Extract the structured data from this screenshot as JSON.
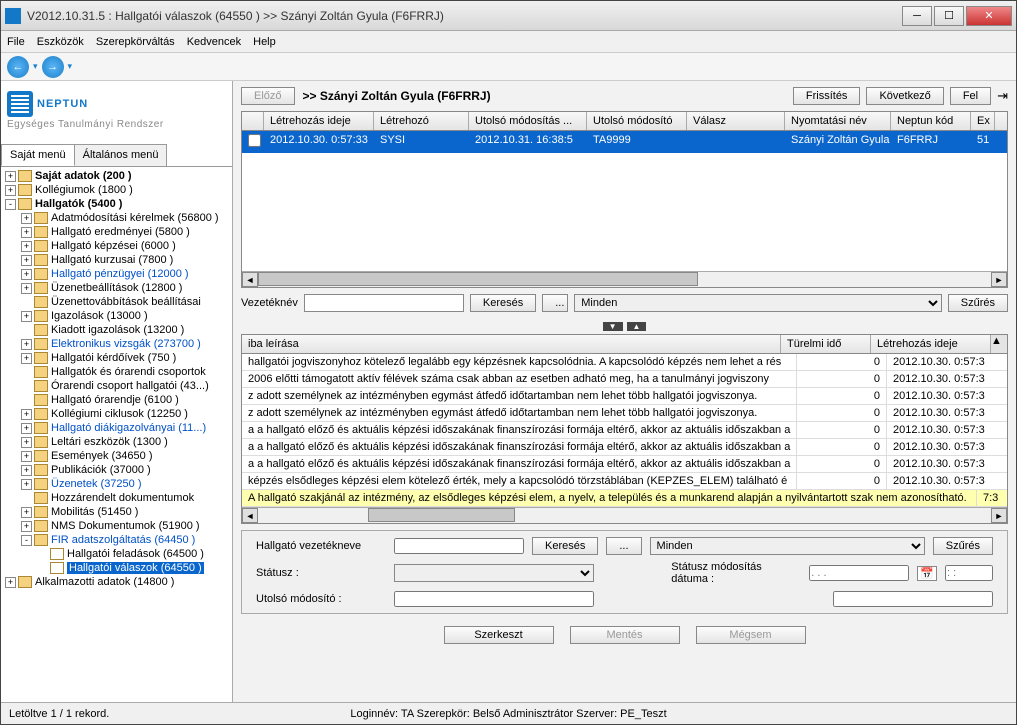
{
  "window": {
    "title": "V2012.10.31.5 : Hallgatói válaszok (64550  )  >> Szányi Zoltán Gyula (F6FRRJ)"
  },
  "menu": {
    "items": [
      "File",
      "Eszközök",
      "Szerepkörváltás",
      "Kedvencek",
      "Help"
    ]
  },
  "logo": {
    "main": "NEPTUN",
    "sub": "Egységes Tanulmányi Rendszer"
  },
  "left_tabs": {
    "t1": "Saját menü",
    "t2": "Általános menü"
  },
  "tree": [
    {
      "level": 1,
      "pm": "+",
      "label": "Saját adatok (200  )",
      "bold": true
    },
    {
      "level": 1,
      "pm": "+",
      "label": "Kollégiumok (1800  )"
    },
    {
      "level": 1,
      "pm": "-",
      "label": "Hallgatók (5400  )",
      "bold": true
    },
    {
      "level": 2,
      "pm": "+",
      "label": "Adatmódosítási kérelmek (56800  )"
    },
    {
      "level": 2,
      "pm": "+",
      "label": "Hallgató eredményei (5800  )"
    },
    {
      "level": 2,
      "pm": "+",
      "label": "Hallgató képzései (6000  )"
    },
    {
      "level": 2,
      "pm": "+",
      "label": "Hallgató kurzusai (7800  )"
    },
    {
      "level": 2,
      "pm": "+",
      "label": "Hallgató pénzügyei (12000  )",
      "blue": true
    },
    {
      "level": 2,
      "pm": "+",
      "label": "Üzenetbeállítások (12800  )"
    },
    {
      "level": 2,
      "pm": " ",
      "label": "Üzenettovábbítások beállításai"
    },
    {
      "level": 2,
      "pm": "+",
      "label": "Igazolások (13000  )"
    },
    {
      "level": 2,
      "pm": " ",
      "label": "Kiadott igazolások (13200  )"
    },
    {
      "level": 2,
      "pm": "+",
      "label": "Elektronikus vizsgák (273700  )",
      "blue": true
    },
    {
      "level": 2,
      "pm": "+",
      "label": "Hallgatói kérdőívek (750  )"
    },
    {
      "level": 2,
      "pm": " ",
      "label": "Hallgatók és órarendi csoportok"
    },
    {
      "level": 2,
      "pm": " ",
      "label": "Órarendi csoport hallgatói (43...)"
    },
    {
      "level": 2,
      "pm": " ",
      "label": "Hallgató órarendje (6100  )"
    },
    {
      "level": 2,
      "pm": "+",
      "label": "Kollégiumi ciklusok (12250  )"
    },
    {
      "level": 2,
      "pm": "+",
      "label": "Hallgató diákigazolványai (11...)",
      "blue": true
    },
    {
      "level": 2,
      "pm": "+",
      "label": "Leltári eszközök (1300  )"
    },
    {
      "level": 2,
      "pm": "+",
      "label": "Események (34650  )"
    },
    {
      "level": 2,
      "pm": "+",
      "label": "Publikációk (37000  )"
    },
    {
      "level": 2,
      "pm": "+",
      "label": "Üzenetek (37250  )",
      "blue": true
    },
    {
      "level": 2,
      "pm": " ",
      "label": "Hozzárendelt dokumentumok"
    },
    {
      "level": 2,
      "pm": "+",
      "label": "Mobilitás (51450  )"
    },
    {
      "level": 2,
      "pm": "+",
      "label": "NMS Dokumentumok (51900  )"
    },
    {
      "level": 2,
      "pm": "-",
      "label": "FIR adatszolgáltatás (64450  )",
      "blue": true
    },
    {
      "level": 3,
      "pm": " ",
      "label": "Hallgatói feladások (64500  )",
      "ico": "doc"
    },
    {
      "level": 3,
      "pm": " ",
      "label": "Hallgatói válaszok (64550  )",
      "ico": "doc",
      "selected": true
    },
    {
      "level": 1,
      "pm": "+",
      "label": "Alkalmazotti adatok (14800  )"
    }
  ],
  "top_toolbar": {
    "prev": "Előző",
    "breadcrumb": ">> Szányi Zoltán Gyula (F6FRRJ)",
    "refresh": "Frissítés",
    "next": "Következő",
    "up": "Fel"
  },
  "grid": {
    "cols": {
      "chk": "",
      "ct": "Létrehozás ideje",
      "cb": "Létrehozó",
      "mt": "Utolsó módosítás ...",
      "mb": "Utolsó módosító",
      "vl": "Válasz",
      "nn": "Nyomtatási név",
      "nk": "Neptun kód",
      "ex": "Ex"
    },
    "row": {
      "ct": "2012.10.30. 0:57:33",
      "cb": "SYSI",
      "mt": "2012.10.31. 16:38:5",
      "mb": "TA9999",
      "vl": "",
      "nn": "Szányi Zoltán Gyula",
      "nk": "F6FRRJ",
      "ex": "51"
    }
  },
  "search1": {
    "label": "Vezetéknév",
    "btn": "Keresés",
    "all": "Minden",
    "filter": "Szűrés"
  },
  "errors": {
    "h1": "iba leírása",
    "h2": "Türelmi idő",
    "h3": "Létrehozás ideje",
    "rows": [
      {
        "t": "hallgatói jogviszonyhoz kötelező legalább egy képzésnek kapcsolódnia. A kapcsolódó képzés nem lehet a rés",
        "v": "0",
        "d": "2012.10.30. 0:57:3"
      },
      {
        "t": "2006 előtti támogatott aktív félévek száma csak abban az esetben adható meg, ha a tanulmányi jogviszony",
        "v": "0",
        "d": "2012.10.30. 0:57:3"
      },
      {
        "t": "z adott személynek az intézményben egymást átfedő időtartamban nem lehet több hallgatói jogviszonya.",
        "v": "0",
        "d": "2012.10.30. 0:57:3"
      },
      {
        "t": "z adott személynek az intézményben egymást átfedő időtartamban nem lehet több hallgatói jogviszonya.",
        "v": "0",
        "d": "2012.10.30. 0:57:3"
      },
      {
        "t": "a a hallgató előző és aktuális képzési időszakának finanszírozási formája eltérő, akkor az aktuális időszakban a",
        "v": "0",
        "d": "2012.10.30. 0:57:3"
      },
      {
        "t": "a a hallgató előző és aktuális képzési időszakának finanszírozási formája eltérő, akkor az aktuális időszakban a",
        "v": "0",
        "d": "2012.10.30. 0:57:3"
      },
      {
        "t": "a a hallgató előző és aktuális képzési időszakának finanszírozási formája eltérő, akkor az aktuális időszakban a",
        "v": "0",
        "d": "2012.10.30. 0:57:3"
      },
      {
        "t": "képzés elsődleges képzési elem kötelező érték, mely a kapcsolódó törzstáblában (KEPZES_ELEM) található é",
        "v": "0",
        "d": "2012.10.30. 0:57:3"
      }
    ],
    "highlight": {
      "t": "A hallgató szakjánál az intézmény, az elsődleges képzési elem, a nyelv, a település és a munkarend alapján a nyilvántartott szak nem azonosítható.",
      "d": "7:3"
    }
  },
  "form": {
    "search_label": "Hallgató vezetékneve",
    "search_btn": "Keresés",
    "all": "Minden",
    "filter": "Szűrés",
    "status": "Státusz :",
    "status_date": "Státusz módosítás dátuma :",
    "date_placeholder": ". . .",
    "time_placeholder": ": :",
    "last_mod": "Utolsó módosító :"
  },
  "btns": {
    "edit": "Szerkeszt",
    "save": "Mentés",
    "cancel": "Mégsem"
  },
  "status": {
    "left": "Letöltve 1 / 1 rekord.",
    "center": "Loginnév: TA   Szerepkör: Belső Adminisztrátor   Szerver: PE_Teszt"
  }
}
